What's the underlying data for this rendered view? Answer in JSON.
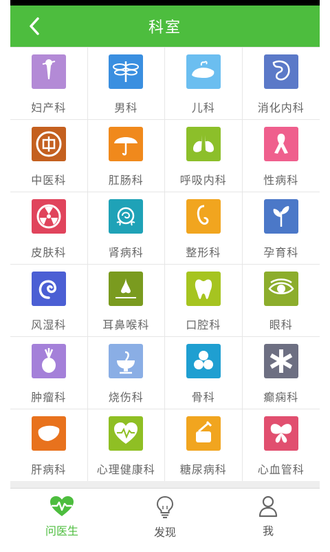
{
  "header": {
    "title": "科室",
    "back_icon": "back-arrow-icon"
  },
  "departments": [
    {
      "label": "妇产科",
      "icon": "female-figure-icon",
      "color": "#b38ad6"
    },
    {
      "label": "男科",
      "icon": "dragonfly-icon",
      "color": "#3a8fe0"
    },
    {
      "label": "儿科",
      "icon": "whale-icon",
      "color": "#6bbef0"
    },
    {
      "label": "消化内科",
      "icon": "stomach-icon",
      "color": "#5b79c8"
    },
    {
      "label": "中医科",
      "icon": "chinese-coin-icon",
      "color": "#c4601f"
    },
    {
      "label": "肛肠科",
      "icon": "umbrella-icon",
      "color": "#f0891c"
    },
    {
      "label": "呼吸内科",
      "icon": "lungs-icon",
      "color": "#8cbf2a"
    },
    {
      "label": "性病科",
      "icon": "ribbon-icon",
      "color": "#ef5f8d"
    },
    {
      "label": "皮肤科",
      "icon": "radiation-icon",
      "color": "#e0445c"
    },
    {
      "label": "肾病科",
      "icon": "rose-icon",
      "color": "#1fa2b7"
    },
    {
      "label": "整形科",
      "icon": "face-outline-icon",
      "color": "#f1a51f"
    },
    {
      "label": "孕育科",
      "icon": "sprout-icon",
      "color": "#4b78c8"
    },
    {
      "label": "风湿科",
      "icon": "spiral-icon",
      "color": "#4b5fd4"
    },
    {
      "label": "耳鼻喉科",
      "icon": "nose-icon",
      "color": "#7a9b1f"
    },
    {
      "label": "口腔科",
      "icon": "tooth-icon",
      "color": "#a6c420"
    },
    {
      "label": "眼科",
      "icon": "eye-icon",
      "color": "#8cad2c"
    },
    {
      "label": "肿瘤科",
      "icon": "pineapple-icon",
      "color": "#a480d9"
    },
    {
      "label": "烧伤科",
      "icon": "pharmacy-bowl-icon",
      "color": "#8aaee5"
    },
    {
      "label": "骨科",
      "icon": "bone-joint-icon",
      "color": "#1f9fd1"
    },
    {
      "label": "癫痫科",
      "icon": "star-of-life-icon",
      "color": "#6d6f82"
    },
    {
      "label": "肝病科",
      "icon": "liver-icon",
      "color": "#e8721d"
    },
    {
      "label": "心理健康科",
      "icon": "heartbeat-icon",
      "color": "#8fbf24"
    },
    {
      "label": "糖尿病科",
      "icon": "insulin-icon",
      "color": "#f1a51f"
    },
    {
      "label": "心血管科",
      "icon": "butterfly-icon",
      "color": "#e14f6f"
    }
  ],
  "tabbar": [
    {
      "label": "问医生",
      "icon": "heart-pulse-icon",
      "active": true
    },
    {
      "label": "发现",
      "icon": "lightbulb-icon",
      "active": false
    },
    {
      "label": "我",
      "icon": "person-icon",
      "active": false
    }
  ],
  "colors": {
    "brand": "#4dbd3e"
  }
}
